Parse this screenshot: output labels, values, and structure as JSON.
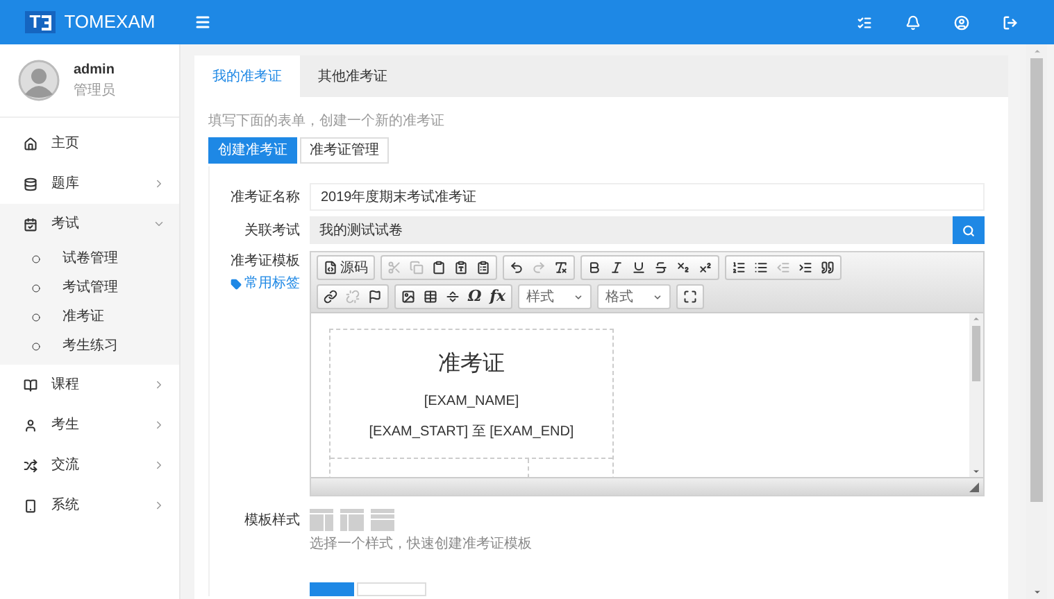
{
  "header": {
    "logo_letter": "T",
    "brand": "TOMEXAM"
  },
  "user": {
    "name": "admin",
    "role": "管理员"
  },
  "sidebar": {
    "items": [
      {
        "label": "主页"
      },
      {
        "label": "题库",
        "expanded": false
      },
      {
        "label": "考试",
        "expanded": true,
        "children": [
          {
            "label": "试卷管理"
          },
          {
            "label": "考试管理"
          },
          {
            "label": "准考证"
          },
          {
            "label": "考生练习"
          }
        ]
      },
      {
        "label": "课程",
        "expanded": false
      },
      {
        "label": "考生",
        "expanded": false
      },
      {
        "label": "交流",
        "expanded": false
      },
      {
        "label": "系统",
        "expanded": false
      }
    ]
  },
  "tabs": [
    {
      "label": "我的准考证",
      "selected": true
    },
    {
      "label": "其他准考证",
      "selected": false
    }
  ],
  "hint": "填写下面的表单，创建一个新的准考证",
  "action_buttons": [
    {
      "label": "创建准考证",
      "selected": true
    },
    {
      "label": "准考证管理",
      "selected": false
    }
  ],
  "form": {
    "name": {
      "label": "准考证名称",
      "value": "2019年度期末考试准考证"
    },
    "exam": {
      "label": "关联考试",
      "value": "我的测试试卷"
    },
    "template": {
      "label": "准考证模板",
      "tags_link": "常用标签",
      "toolbar_rows": [
        [
          {
            "kind": "group",
            "items": [
              {
                "label": "源码",
                "disabled": false
              }
            ]
          },
          {
            "kind": "group",
            "items": [
              {
                "disabled": true
              },
              {
                "disabled": true
              },
              {
                "disabled": false
              },
              {
                "disabled": false
              },
              {
                "disabled": false
              }
            ]
          },
          {
            "kind": "group",
            "items": [
              {
                "disabled": false
              },
              {
                "disabled": true
              },
              {
                "disabled": false
              }
            ]
          },
          {
            "kind": "group",
            "items": [
              {
                "disabled": false
              },
              {
                "disabled": false
              },
              {
                "disabled": false
              },
              {
                "disabled": false
              },
              {
                "disabled": false
              },
              {
                "disabled": false
              }
            ]
          },
          {
            "kind": "group",
            "items": [
              {
                "disabled": false
              },
              {
                "disabled": false
              },
              {
                "disabled": true
              },
              {
                "disabled": false
              },
              {
                "disabled": false
              }
            ]
          }
        ],
        [
          {
            "kind": "group",
            "items": [
              {
                "disabled": false
              },
              {
                "disabled": true
              },
              {
                "disabled": false
              }
            ]
          },
          {
            "kind": "group",
            "items": [
              {
                "disabled": false
              },
              {
                "disabled": false
              },
              {
                "disabled": false
              },
              {
                "text": "Ω",
                "disabled": false
              },
              {
                "text": "fx",
                "disabled": false
              }
            ]
          },
          {
            "kind": "combo",
            "label": "样式"
          },
          {
            "kind": "combo",
            "label": "格式"
          },
          {
            "kind": "group",
            "items": [
              {
                "disabled": false
              }
            ]
          }
        ]
      ],
      "content": {
        "title": "准考证",
        "lines": [
          "[EXAM_NAME]",
          "[EXAM_START] 至 [EXAM_END]"
        ]
      }
    },
    "style": {
      "label": "模板样式",
      "hint": "选择一个样式，快速创建准考证模板"
    }
  }
}
